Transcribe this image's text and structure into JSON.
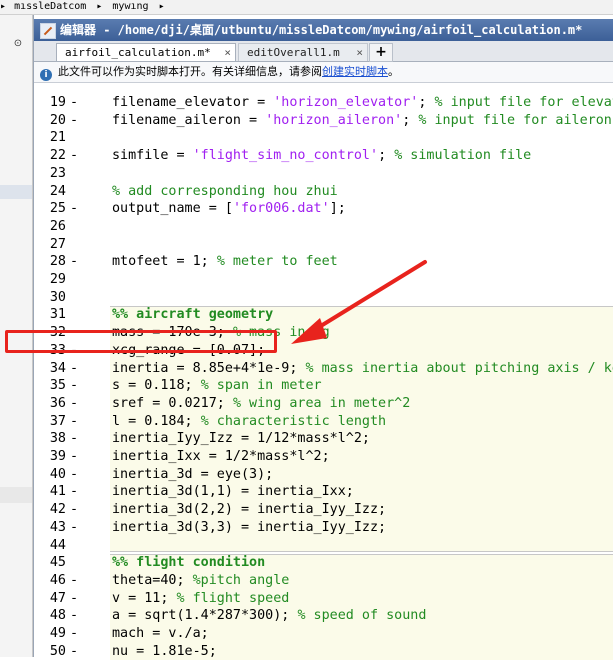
{
  "breadcrumb": {
    "items": [
      "mıssleDatcom",
      "mywıng"
    ],
    "separator": "▸"
  },
  "left_panel": {
    "dropdown_glyph": "⊙"
  },
  "window": {
    "title": "编辑器 - /home/dji/桌面/utbuntu/missleDatcom/mywing/airfoil_calculation.m*"
  },
  "tabs": [
    {
      "label": "airfoil_calculation.m*",
      "close": "×",
      "active": true
    },
    {
      "label": "editOverall1.m",
      "close": "×",
      "active": false
    }
  ],
  "tab_add_label": "+",
  "info_bar": {
    "icon": "i",
    "text": "此文件可以作为实时脚本打开。有关详细信息，请参阅",
    "link": "创建实时脚本",
    "tail": "。"
  },
  "code_lines": [
    {
      "n": "19",
      "dash": "-",
      "code": "filename_elevator = ",
      "str": "'horizon_elevator'",
      "post": "; ",
      "cmt": "% input file for elevator"
    },
    {
      "n": "20",
      "dash": "-",
      "code": "filename_aileron = ",
      "str": "'horizon_aileron'",
      "post": "; ",
      "cmt": "% input file for aileron"
    },
    {
      "n": "21",
      "dash": "",
      "code": "",
      "str": "",
      "post": "",
      "cmt": ""
    },
    {
      "n": "22",
      "dash": "-",
      "code": "simfile = ",
      "str": "'flight_sim_no_control'",
      "post": "; ",
      "cmt": "% simulation file"
    },
    {
      "n": "23",
      "dash": "",
      "code": "",
      "str": "",
      "post": "",
      "cmt": ""
    },
    {
      "n": "24",
      "dash": "",
      "code": "",
      "str": "",
      "post": "",
      "cmt": "% add corresponding hou zhui"
    },
    {
      "n": "25",
      "dash": "-",
      "code": "output_name = [",
      "str": "'for006.dat'",
      "post": "];",
      "cmt": ""
    },
    {
      "n": "26",
      "dash": "",
      "code": "",
      "str": "",
      "post": "",
      "cmt": ""
    },
    {
      "n": "27",
      "dash": "",
      "code": "",
      "str": "",
      "post": "",
      "cmt": ""
    },
    {
      "n": "28",
      "dash": "-",
      "code": "mtofeet = 1; ",
      "str": "",
      "post": "",
      "cmt": "% meter to feet"
    },
    {
      "n": "29",
      "dash": "",
      "code": "",
      "str": "",
      "post": "",
      "cmt": ""
    },
    {
      "n": "30",
      "dash": "",
      "code": "",
      "str": "",
      "post": "",
      "cmt": ""
    },
    {
      "n": "31",
      "dash": "",
      "code": "",
      "str": "",
      "post": "",
      "cmt": "",
      "cell": "%% aircraft geometry"
    },
    {
      "n": "32",
      "dash": "-",
      "code": "mass = 170e-3; ",
      "str": "",
      "post": "",
      "cmt": "% mass in kg"
    },
    {
      "n": "33",
      "dash": "-",
      "code": "xcg_range = [0.07];",
      "str": "",
      "post": "",
      "cmt": ""
    },
    {
      "n": "34",
      "dash": "-",
      "code": "inertia = 8.85e+4*1e-9; ",
      "str": "",
      "post": "",
      "cmt": "% mass inertia about pitching axis / kg"
    },
    {
      "n": "35",
      "dash": "-",
      "code": "s = 0.118; ",
      "str": "",
      "post": "",
      "cmt": "% span in meter"
    },
    {
      "n": "36",
      "dash": "-",
      "code": "sref = 0.0217; ",
      "str": "",
      "post": "",
      "cmt": "% wing area in meter^2"
    },
    {
      "n": "37",
      "dash": "-",
      "code": "l = 0.184; ",
      "str": "",
      "post": "",
      "cmt": "% characteristic length"
    },
    {
      "n": "38",
      "dash": "-",
      "code": "inertia_Iyy_Izz = 1/12*mass*l^2;",
      "str": "",
      "post": "",
      "cmt": ""
    },
    {
      "n": "39",
      "dash": "-",
      "code": "inertia_Ixx = 1/2*mass*l^2;",
      "str": "",
      "post": "",
      "cmt": ""
    },
    {
      "n": "40",
      "dash": "-",
      "code": "inertia_3d = eye(3);",
      "str": "",
      "post": "",
      "cmt": ""
    },
    {
      "n": "41",
      "dash": "-",
      "code": "inertia_3d(1,1) = inertia_Ixx;",
      "str": "",
      "post": "",
      "cmt": ""
    },
    {
      "n": "42",
      "dash": "-",
      "code": "inertia_3d(2,2) = inertia_Iyy_Izz;",
      "str": "",
      "post": "",
      "cmt": ""
    },
    {
      "n": "43",
      "dash": "-",
      "code": "inertia_3d(3,3) = inertia_Iyy_Izz;",
      "str": "",
      "post": "",
      "cmt": ""
    },
    {
      "n": "44",
      "dash": "",
      "code": "",
      "str": "",
      "post": "",
      "cmt": ""
    },
    {
      "n": "45",
      "dash": "",
      "code": "",
      "str": "",
      "post": "",
      "cmt": "",
      "cell": "%% flight condition"
    },
    {
      "n": "46",
      "dash": "-",
      "code": "theta=40; ",
      "str": "",
      "post": "",
      "cmt": "%pitch angle"
    },
    {
      "n": "47",
      "dash": "-",
      "code": "v = 11; ",
      "str": "",
      "post": "",
      "cmt": "% flight speed"
    },
    {
      "n": "48",
      "dash": "-",
      "code": "a = sqrt(1.4*287*300); ",
      "str": "",
      "post": "",
      "cmt": "% speed of sound"
    },
    {
      "n": "49",
      "dash": "-",
      "code": "mach = v./a;",
      "str": "",
      "post": "",
      "cmt": ""
    },
    {
      "n": "50",
      "dash": "-",
      "code": "nu = 1.81e-5;",
      "str": "",
      "post": "",
      "cmt": ""
    }
  ],
  "colors": {
    "comment": "#228b22",
    "string": "#a020f0",
    "cell_background": "#fbfbe9",
    "annotation_red": "#e8231d",
    "title_bar": "#4a6da5"
  }
}
